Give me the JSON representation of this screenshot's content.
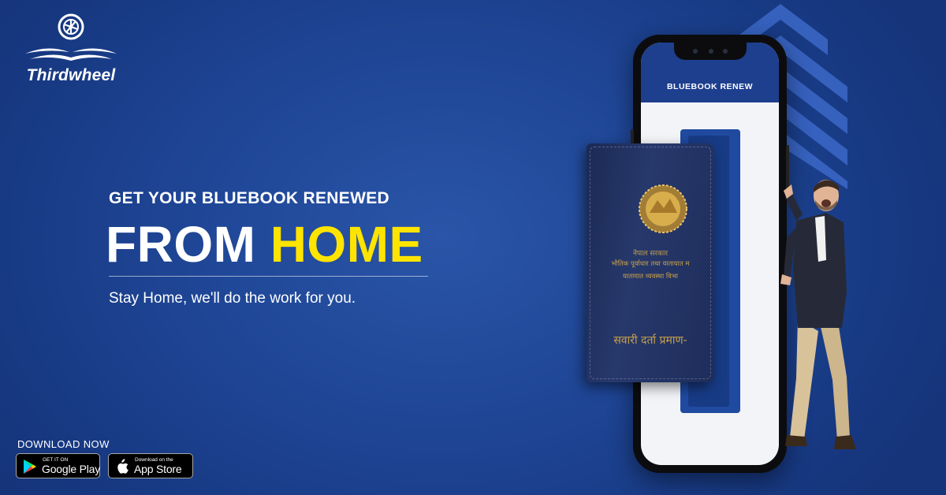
{
  "brand": {
    "name": "Thirdwheel"
  },
  "headline": {
    "eyebrow": "GET YOUR BLUEBOOK RENEWED",
    "main_white": "FROM",
    "main_yellow": "HOME",
    "tagline": "Stay Home, we'll do the work for you."
  },
  "download": {
    "label": "DOWNLOAD NOW",
    "google_play": {
      "small": "GET IT ON",
      "big": "Google Play"
    },
    "app_store": {
      "small": "Download on the",
      "big": "App Store"
    }
  },
  "phone": {
    "screen_title": "BLUEBOOK RENEW"
  },
  "bluebook": {
    "line1": "नेपाल सरकार",
    "line2": "भौतिक पूर्वाधार तथा यातायात म",
    "line3": "यातायात व्यवस्था विभा",
    "line4": "सवारी दर्ता प्रमाण-"
  },
  "colors": {
    "background": "#1f4696",
    "accent_yellow": "#ffe400",
    "white": "#ffffff"
  },
  "icons": [
    "wheel-logo-icon",
    "google-play-icon",
    "apple-icon",
    "chevron-arrows-icon"
  ]
}
